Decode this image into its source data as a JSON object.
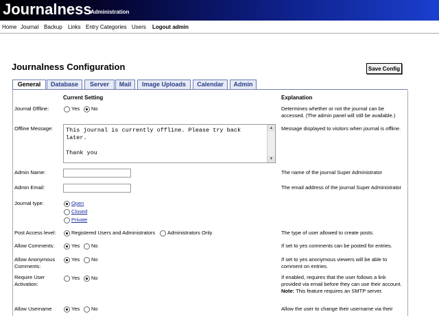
{
  "header": {
    "logo": "Journalness",
    "subtitle": "Administration"
  },
  "nav": {
    "items": [
      "Home",
      "Journal",
      "Backup",
      "Links",
      "Entry Categories",
      "Users"
    ],
    "logout": "Logout admin"
  },
  "page": {
    "title": "Journalness Configuration",
    "save_label": "Save Config"
  },
  "tabs": [
    "General",
    "Database",
    "Server",
    "Mail",
    "Image Uploads",
    "Calendar",
    "Admin"
  ],
  "table": {
    "col_setting": "Current Setting",
    "col_explanation": "Explanation"
  },
  "rows": {
    "journal_offline": {
      "label": "Journal Offline:",
      "yes": "Yes",
      "no": "No",
      "explanation": "Determines whether or not the journal can be accessed. (The admin panel will still be available.)"
    },
    "offline_message": {
      "label": "Offline Message:",
      "value": "This journal is currently offline. Please try back later.\n\nThank you",
      "explanation": "Message displayed to visitors when journal is offline."
    },
    "admin_name": {
      "label": "Admin Name:",
      "value": "",
      "explanation": "The name of the journal Super Administrator"
    },
    "admin_email": {
      "label": "Admin Email:",
      "value": "",
      "explanation": "The email address of the journal Super Administrator"
    },
    "journal_type": {
      "label": "Journal type:",
      "options": [
        "Open",
        "Closed",
        "Private"
      ]
    },
    "post_access": {
      "label": "Post Access level:",
      "opt1": "Registered Users and Administrators",
      "opt2": "Administrators Only",
      "explanation": "The type of user allowed to create posts."
    },
    "allow_comments": {
      "label": "Allow Comments:",
      "yes": "Yes",
      "no": "No",
      "explanation": "If set to yes comments can be posted for entries."
    },
    "allow_anon": {
      "label": "Allow Anonymous Comments:",
      "yes": "Yes",
      "no": "No",
      "explanation": "If set to yes anonymous viewers will be able to comment on entries."
    },
    "require_activation": {
      "label": "Require User Activation:",
      "yes": "Yes",
      "no": "No",
      "explanation_a": "If enabled, requires that the user follows a link provided via email before they can use their account. ",
      "explanation_note": "Note:",
      "explanation_b": " This feature requires an SMTP server."
    },
    "allow_username": {
      "label": "Allow Username",
      "yes": "Yes",
      "no": "No",
      "explanation": "Allow the user to change their username via their"
    }
  }
}
